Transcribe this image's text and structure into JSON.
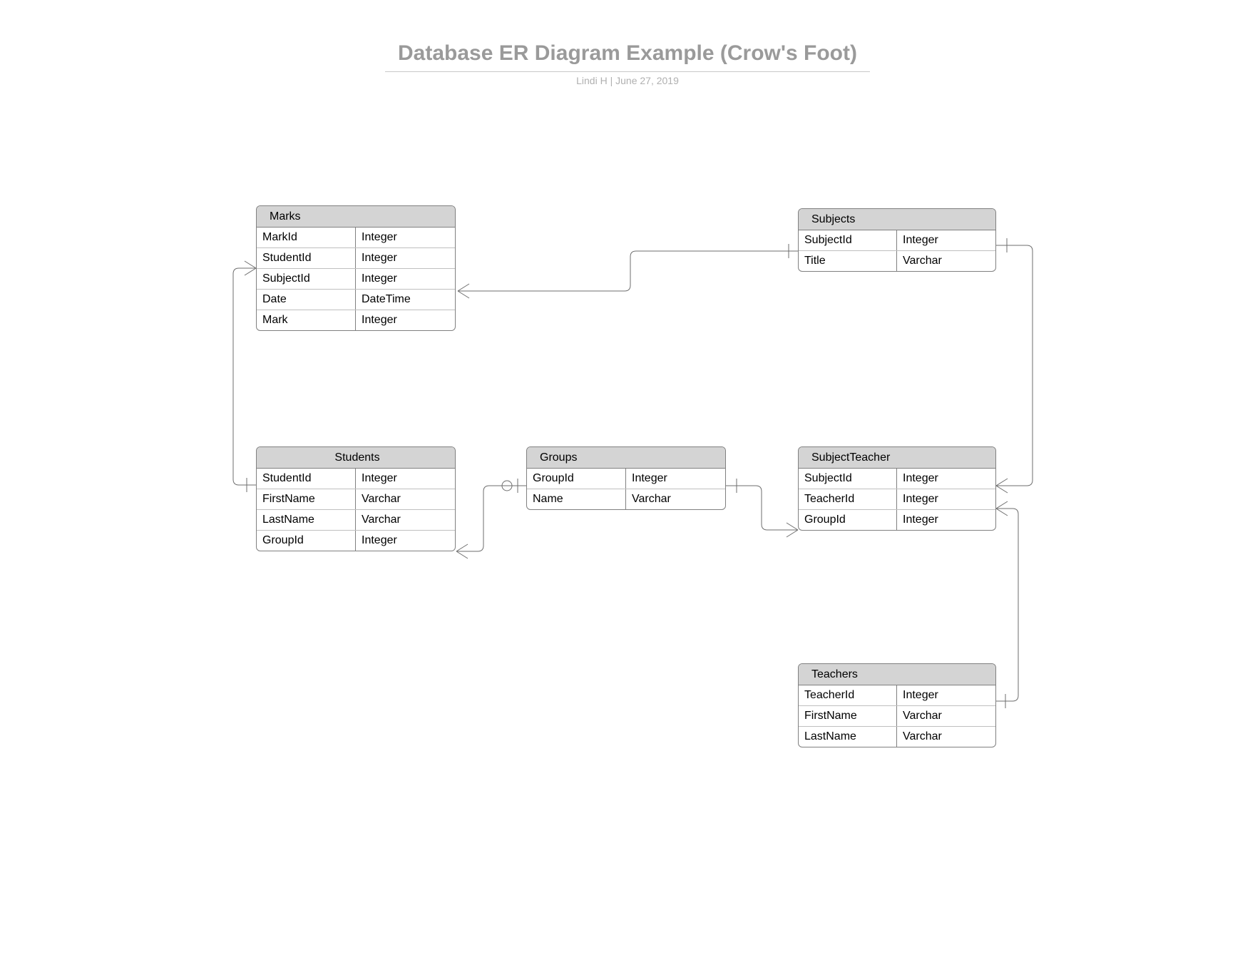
{
  "header": {
    "title": "Database ER Diagram Example (Crow's Foot)",
    "subtitle": "Lindi H  |  June 27, 2019"
  },
  "entities": {
    "marks": {
      "title": "Marks",
      "fields": [
        {
          "name": "MarkId",
          "type": "Integer"
        },
        {
          "name": "StudentId",
          "type": "Integer"
        },
        {
          "name": "SubjectId",
          "type": "Integer"
        },
        {
          "name": "Date",
          "type": "DateTime"
        },
        {
          "name": "Mark",
          "type": "Integer"
        }
      ]
    },
    "subjects": {
      "title": "Subjects",
      "fields": [
        {
          "name": "SubjectId",
          "type": "Integer"
        },
        {
          "name": "Title",
          "type": "Varchar"
        }
      ]
    },
    "students": {
      "title": "Students",
      "fields": [
        {
          "name": "StudentId",
          "type": "Integer"
        },
        {
          "name": "FirstName",
          "type": "Varchar"
        },
        {
          "name": "LastName",
          "type": "Varchar"
        },
        {
          "name": "GroupId",
          "type": "Integer"
        }
      ]
    },
    "groups": {
      "title": "Groups",
      "fields": [
        {
          "name": "GroupId",
          "type": "Integer"
        },
        {
          "name": "Name",
          "type": "Varchar"
        }
      ]
    },
    "subjectteacher": {
      "title": "SubjectTeacher",
      "fields": [
        {
          "name": "SubjectId",
          "type": "Integer"
        },
        {
          "name": "TeacherId",
          "type": "Integer"
        },
        {
          "name": "GroupId",
          "type": "Integer"
        }
      ]
    },
    "teachers": {
      "title": "Teachers",
      "fields": [
        {
          "name": "TeacherId",
          "type": "Integer"
        },
        {
          "name": "FirstName",
          "type": "Varchar"
        },
        {
          "name": "LastName",
          "type": "Varchar"
        }
      ]
    }
  },
  "relationships": [
    {
      "from": "Marks",
      "to": "Subjects",
      "from_card": "many",
      "to_card": "one"
    },
    {
      "from": "Marks",
      "to": "Students",
      "from_card": "many",
      "to_card": "one"
    },
    {
      "from": "Students",
      "to": "Groups",
      "from_card": "many",
      "to_card": "zero-or-one"
    },
    {
      "from": "Groups",
      "to": "SubjectTeacher",
      "from_card": "one",
      "to_card": "many"
    },
    {
      "from": "Subjects",
      "to": "SubjectTeacher",
      "from_card": "one",
      "to_card": "many"
    },
    {
      "from": "Teachers",
      "to": "SubjectTeacher",
      "from_card": "one",
      "to_card": "many"
    }
  ]
}
